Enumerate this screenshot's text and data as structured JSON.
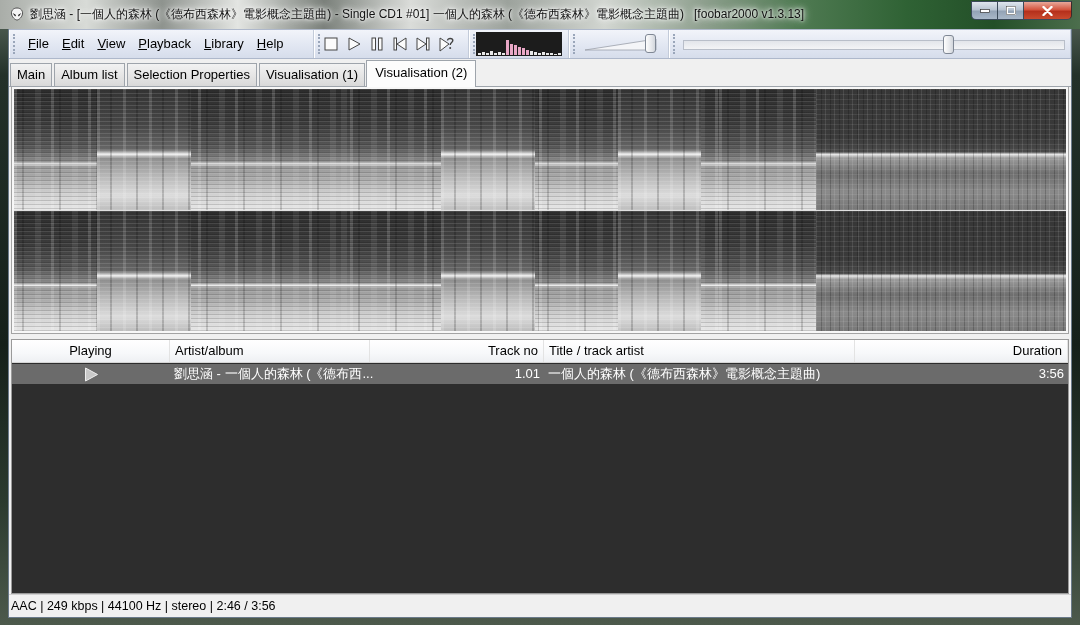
{
  "window": {
    "title": "劉思涵 - [一個人的森林 (《德布西森林》電影概念主題曲) - Single CD1 #01] 一個人的森林 (《德布西森林》電影概念主題曲)   [foobar2000 v1.3.13]"
  },
  "menu": [
    "File",
    "Edit",
    "View",
    "Playback",
    "Library",
    "Help"
  ],
  "volume": {
    "level": 0.97
  },
  "seekbar": {
    "level": 0.7
  },
  "tabs": [
    {
      "label": "Main",
      "selected": false
    },
    {
      "label": "Album list",
      "selected": false
    },
    {
      "label": "Selection Properties",
      "selected": false
    },
    {
      "label": "Visualisation (1)",
      "selected": false
    },
    {
      "label": "Visualisation (2)",
      "selected": true
    }
  ],
  "playlist": {
    "columns": [
      "Playing",
      "Artist/album",
      "Track no",
      "Title / track artist",
      "Duration"
    ],
    "rows": [
      {
        "playing": true,
        "selected": true,
        "artist_album": "劉思涵 - 一個人的森林 (《德布西...",
        "track_no": "1.01",
        "title": "一個人的森林 (《德布西森林》電影概念主題曲)",
        "duration": "3:56"
      }
    ]
  },
  "status_bar": "AAC | 249 kbps | 44100 Hz | stereo | 2:46 / 3:56"
}
